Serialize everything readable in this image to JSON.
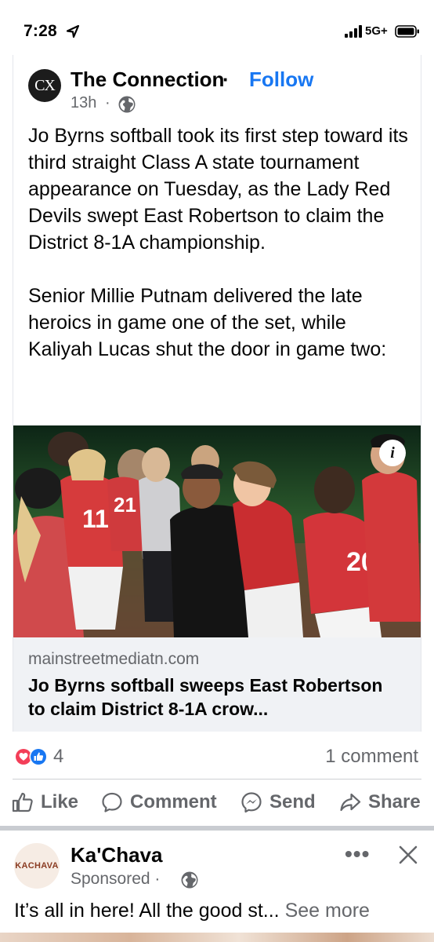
{
  "status_bar": {
    "time": "7:28",
    "network": "5G+"
  },
  "post": {
    "page_name": "The Connection",
    "separator": "·",
    "follow_label": "Follow",
    "avatar_text": "CX",
    "time_ago": "13h",
    "time_separator": "·",
    "audience_icon": "globe-icon",
    "paragraphs": [
      "Jo Byrns softball took its first step toward its third straight Class A state tournament appearance on Tuesday, as the Lady Red Devils swept East Robertson to claim the District 8-1A championship.",
      "Senior Millie Putnam delivered the late heroics in game one of the set, while Kaliyah Lucas shut the door in game two:"
    ],
    "image": {
      "jersey_numbers": [
        "11",
        "21",
        "20"
      ],
      "info_label": "i"
    },
    "link": {
      "domain": "mainstreetmediatn.com",
      "title": "Jo Byrns softball sweeps East Robertson to claim District 8-1A crow..."
    },
    "reactions": {
      "count": "4",
      "icons": [
        "love-reaction-icon",
        "like-reaction-icon"
      ]
    },
    "comments": "1 comment",
    "actions": {
      "like": "Like",
      "comment": "Comment",
      "send": "Send",
      "share": "Share"
    }
  },
  "sponsored_post": {
    "logo_text": "KACHAVA",
    "advertiser": "Ka'Chava",
    "label": "Sponsored",
    "separator": "·",
    "more_icon": "•••",
    "text": "It’s all in here! All the good st...",
    "see_more": "See more"
  },
  "colors": {
    "facebook_blue": "#1877f2",
    "secondary_text": "#65676b",
    "love_red": "#f33e58",
    "jersey_red": "#c8232b"
  }
}
